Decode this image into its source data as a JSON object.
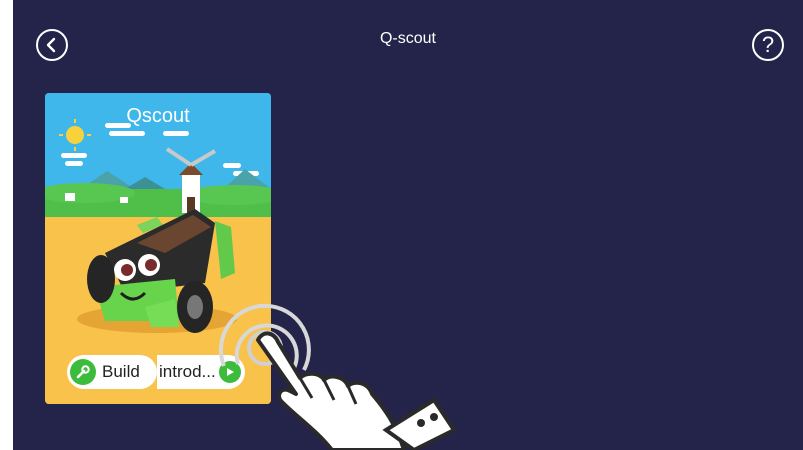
{
  "header": {
    "title": "Q-scout"
  },
  "card": {
    "title": "Qscout",
    "build_label": "Build",
    "intro_label": "introd..."
  },
  "icons": {
    "back": "back-arrow-icon",
    "help": "help-question-icon",
    "build": "wrench-icon",
    "intro": "play-icon",
    "hand": "tap-hand-icon"
  },
  "colors": {
    "background": "#24244a",
    "card_sky": "#3fb7ea",
    "card_ground": "#f9c24a",
    "accent_green": "#3dbb3d"
  }
}
